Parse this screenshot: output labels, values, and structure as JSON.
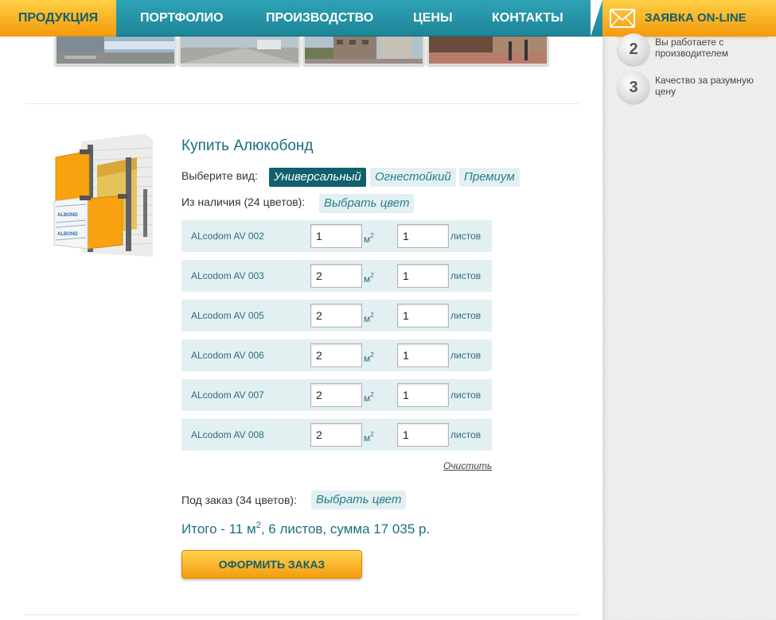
{
  "nav": {
    "items": [
      {
        "label": "ПРОДУКЦИЯ"
      },
      {
        "label": "ПОРТФОЛИО"
      },
      {
        "label": "ПРОИЗВОДСТВО"
      },
      {
        "label": "ЦЕНЫ"
      },
      {
        "label": "КОНТАКТЫ"
      }
    ],
    "active_index": 0
  },
  "sidebar": {
    "title": "ЗАЯВКА ON-LINE",
    "icon": "mail-icon",
    "benefits": [
      {
        "num": "2",
        "text": "Вы работаете с производителем"
      },
      {
        "num": "3",
        "text": "Качество за разумную цену"
      }
    ]
  },
  "product": {
    "title": "Купить Алюкобонд",
    "type_label": "Выберите вид:",
    "types": [
      "Универсальный",
      "Огнестойкий",
      "Премиум"
    ],
    "active_type": "Универсальный",
    "in_stock_label": "Из наличия (24 цветов):",
    "choose_color": "Выбрать цвет",
    "rows": [
      {
        "name": "ALcodom AV 002",
        "area": "1",
        "area_unit": "м",
        "area_exp": "2",
        "sheets": "1",
        "sheets_unit": "листов"
      },
      {
        "name": "ALcodom AV 003",
        "area": "2",
        "area_unit": "м",
        "area_exp": "2",
        "sheets": "1",
        "sheets_unit": "листов"
      },
      {
        "name": "ALcodom AV 005",
        "area": "2",
        "area_unit": "м",
        "area_exp": "2",
        "sheets": "1",
        "sheets_unit": "листов"
      },
      {
        "name": "ALcodom AV 006",
        "area": "2",
        "area_unit": "м",
        "area_exp": "2",
        "sheets": "1",
        "sheets_unit": "листов"
      },
      {
        "name": "ALcodom AV 007",
        "area": "2",
        "area_unit": "м",
        "area_exp": "2",
        "sheets": "1",
        "sheets_unit": "листов"
      },
      {
        "name": "ALcodom AV 008",
        "area": "2",
        "area_unit": "м",
        "area_exp": "2",
        "sheets": "1",
        "sheets_unit": "листов"
      }
    ],
    "clear_label": "Очистить",
    "on_order_label": "Под заказ (34 цветов):",
    "total_prefix": "Итого - 11 м",
    "total_exp": "2",
    "total_suffix": ", 6 листов, сумма 17 035 р.",
    "order_button": "ОФОРМИТЬ ЗАКАЗ"
  },
  "colors": {
    "accent_teal": "#1d8597",
    "accent_orange": "#f39a0c",
    "panel_orange": "#f7a20e",
    "row_bg": "#e3f0f2"
  }
}
